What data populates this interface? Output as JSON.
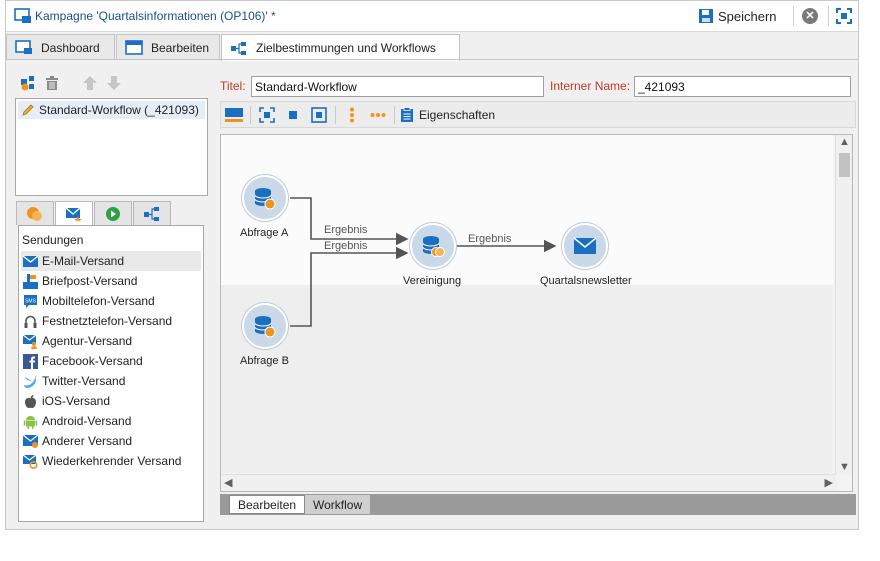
{
  "window": {
    "title": "Kampagne 'Quartalsinformationen (OP106)' *",
    "save_label": "Speichern"
  },
  "tabs": [
    {
      "label": "Dashboard",
      "icon": "dashboard-icon"
    },
    {
      "label": "Bearbeiten",
      "icon": "edit-form-icon"
    },
    {
      "label": "Zielbestimmungen und Workflows",
      "icon": "workflow-icon"
    }
  ],
  "workflow_list": {
    "items": [
      "Standard-Workflow (_421093)"
    ]
  },
  "fields": {
    "title_label": "Titel:",
    "title_value": "Standard-Workflow",
    "internal_name_label": "Interner Name:",
    "internal_name_value": "_421093"
  },
  "wf_toolbar": {
    "properties_label": "Eigenschaften"
  },
  "deliveries": {
    "heading": "Sendungen",
    "items": [
      {
        "label": "E-Mail-Versand",
        "icon": "email-icon"
      },
      {
        "label": "Briefpost-Versand",
        "icon": "letter-icon"
      },
      {
        "label": "Mobiltelefon-Versand",
        "icon": "sms-icon"
      },
      {
        "label": "Festnetztelefon-Versand",
        "icon": "phone-icon"
      },
      {
        "label": "Agentur-Versand",
        "icon": "agency-icon"
      },
      {
        "label": "Facebook-Versand",
        "icon": "facebook-icon"
      },
      {
        "label": "Twitter-Versand",
        "icon": "twitter-icon"
      },
      {
        "label": "iOS-Versand",
        "icon": "apple-icon"
      },
      {
        "label": "Android-Versand",
        "icon": "android-icon"
      },
      {
        "label": "Anderer Versand",
        "icon": "other-delivery-icon"
      },
      {
        "label": "Wiederkehrender Versand",
        "icon": "recurring-delivery-icon"
      }
    ]
  },
  "diagram": {
    "nodes": [
      {
        "id": "query_a",
        "label": "Abfrage A"
      },
      {
        "id": "query_b",
        "label": "Abfrage B"
      },
      {
        "id": "union",
        "label": "Vereinigung"
      },
      {
        "id": "newsletter",
        "label": "Quartalsnewsletter"
      }
    ],
    "links": [
      {
        "from": "query_a",
        "to": "union",
        "label": "Ergebnis"
      },
      {
        "from": "query_b",
        "to": "union",
        "label": "Ergebnis"
      },
      {
        "from": "union",
        "to": "newsletter",
        "label": "Ergebnis"
      }
    ]
  },
  "bottom_tabs": [
    "Bearbeiten",
    "Workflow"
  ],
  "colors": {
    "accent": "#1b6fc2",
    "required_label": "#c0392b",
    "orange": "#f0931e"
  }
}
